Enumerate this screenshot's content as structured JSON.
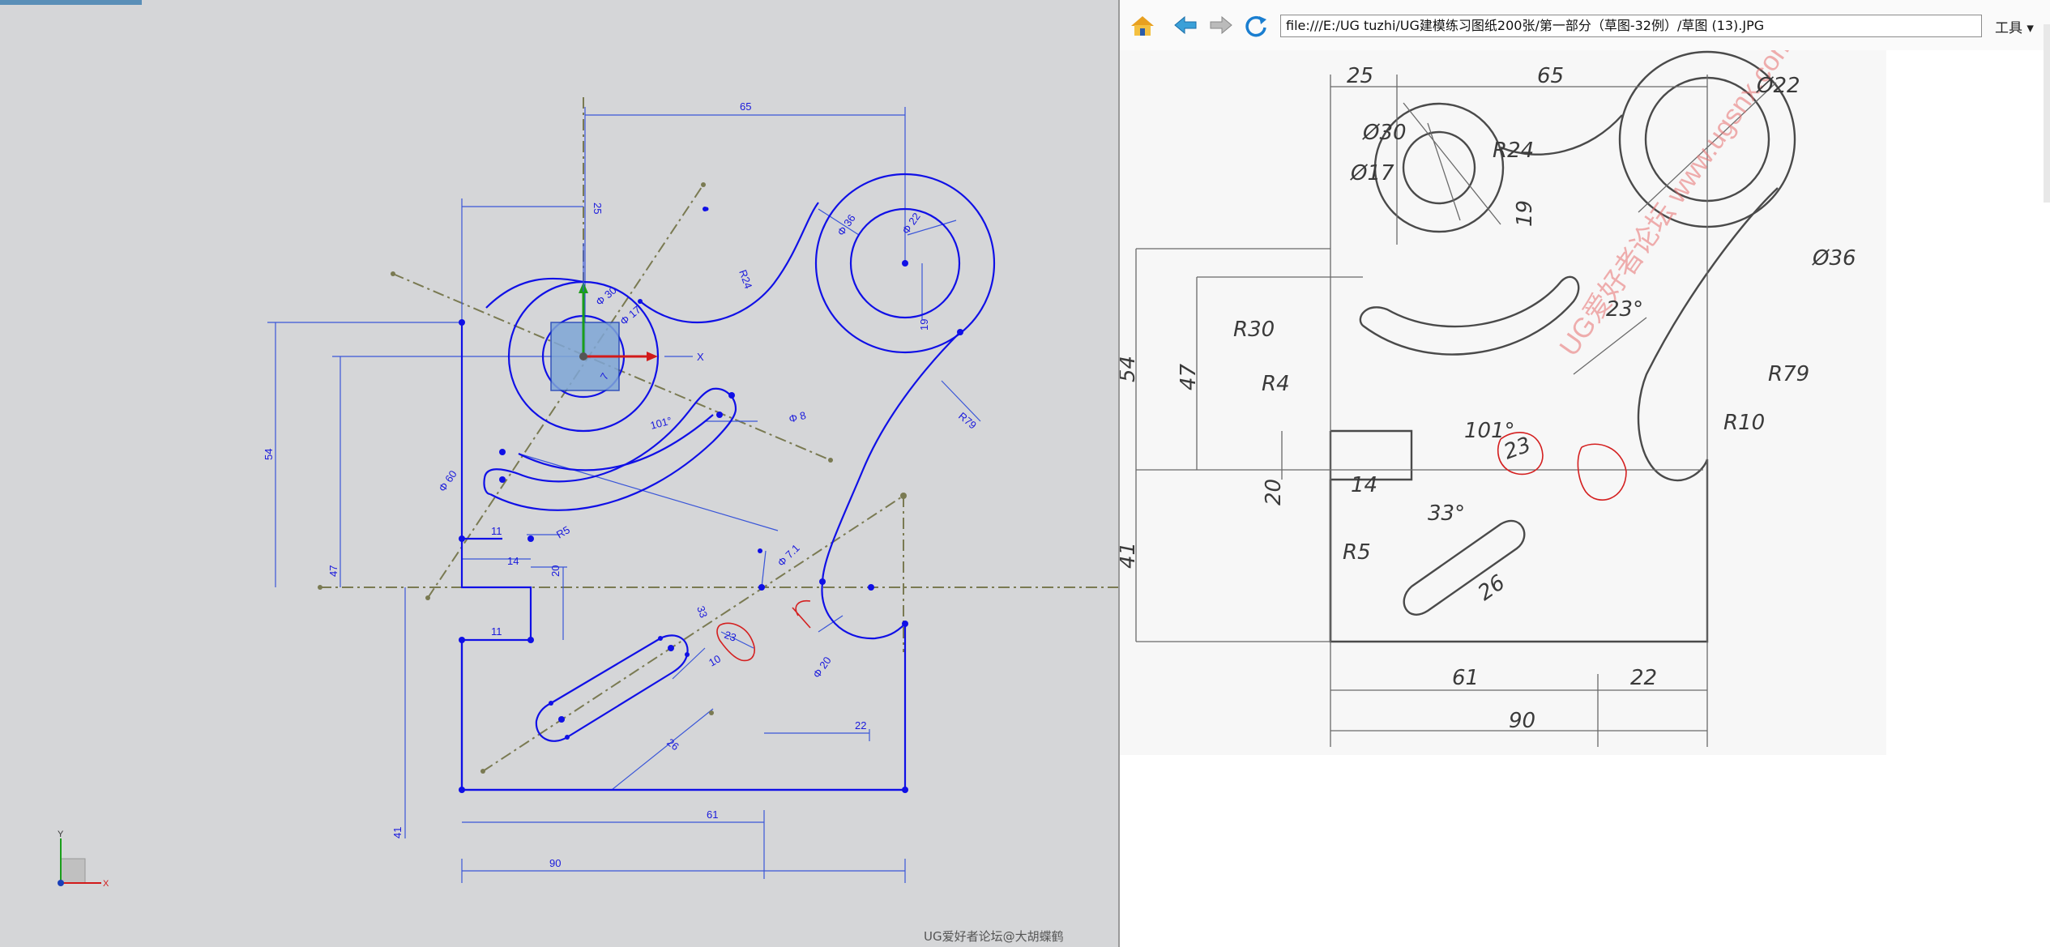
{
  "cad": {
    "dims": {
      "d65": "65",
      "d25": "25",
      "d54": "54",
      "d47": "47",
      "d14": "14",
      "d20": "20",
      "d11": "11",
      "d19": "19",
      "d61": "61",
      "d90": "90",
      "d22": "22",
      "d41": "41",
      "d23": "23",
      "d26": "26",
      "d101": "101°",
      "d10": "10",
      "d8": "Φ 8",
      "phi30": "Φ 30",
      "phi17": "Φ 17",
      "phi22": "Φ 22",
      "phi36": "Φ 36",
      "phi60": "Φ 60",
      "phi71": "Φ 7.1",
      "phi20": "Φ 20",
      "r24": "R24",
      "r79": "R79",
      "r5": "R5",
      "a33": "33",
      "a7": "7",
      "p8": "8"
    },
    "triad": {
      "y": "Y",
      "x": "X"
    },
    "origin_x": "X"
  },
  "browser": {
    "address": "file:///E:/UG tuzhi/UG建模练习图纸200张/第一部分（草图-32例）/草图 (13).JPG",
    "tools_label": "工具 ▾",
    "drawing_labels": {
      "d25": "25",
      "d65": "65",
      "phi22": "Ø22",
      "phi30": "Ø30",
      "phi17": "Ø17",
      "r24": "R24",
      "d19": "19",
      "phi36": "Ø36",
      "r30": "R30",
      "a23": "23°",
      "d54": "54",
      "d47": "47",
      "r79": "R79",
      "r4": "R4",
      "a101": "101°",
      "r10": "R10",
      "d23": "23",
      "d20": "20",
      "d14": "14",
      "a33": "33°",
      "r5": "R5",
      "d41": "41",
      "d26": "26",
      "d61": "61",
      "d22": "22",
      "d90": "90"
    },
    "drawing_watermark": "UG爱好者论坛 www.ugsnx.com",
    "footer": "UG爱好者论坛@大胡蝶鹤"
  }
}
